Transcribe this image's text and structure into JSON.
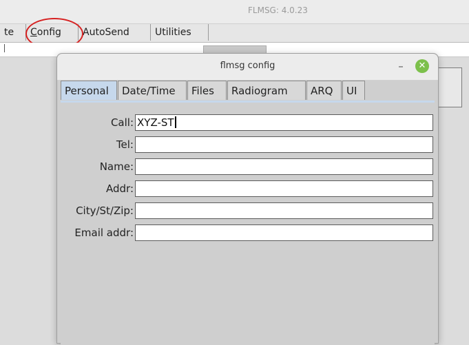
{
  "main_window": {
    "title": "FLMSG: 4.0.23",
    "menu": [
      {
        "label": "te",
        "underline": "",
        "rest": ""
      },
      {
        "label": "",
        "underline": "C",
        "rest": "onfig"
      },
      {
        "label": "AutoSend",
        "underline": "",
        "rest": ""
      },
      {
        "label": "Utilities",
        "underline": "",
        "rest": ""
      }
    ]
  },
  "dialog": {
    "title": "flmsg config",
    "minimize_glyph": "–",
    "close_glyph": "✕",
    "tabs": [
      "Personal",
      "Date/Time",
      "Files",
      "Radiogram",
      "ARQ",
      "UI"
    ],
    "active_tab": "Personal",
    "fields": [
      {
        "label": "Call:",
        "value": "XYZ-ST"
      },
      {
        "label": "Tel:",
        "value": ""
      },
      {
        "label": "Name:",
        "value": ""
      },
      {
        "label": "Addr:",
        "value": ""
      },
      {
        "label": "City/St/Zip:",
        "value": ""
      },
      {
        "label": "Email addr:",
        "value": ""
      }
    ]
  },
  "colors": {
    "annotation_circle": "#d62020",
    "active_tab": "#c6d8ec",
    "close_button": "#7cc04b"
  }
}
